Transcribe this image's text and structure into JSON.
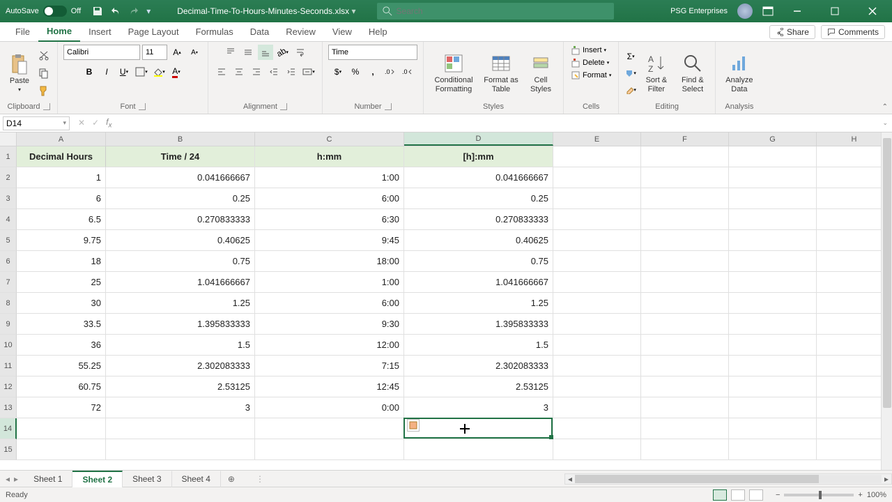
{
  "titlebar": {
    "autosave_label": "AutoSave",
    "autosave_state": "Off",
    "filename": "Decimal-Time-To-Hours-Minutes-Seconds.xlsx",
    "search_placeholder": "Search",
    "user_label": "PSG Enterprises"
  },
  "ribbon_tabs": [
    "File",
    "Home",
    "Insert",
    "Page Layout",
    "Formulas",
    "Data",
    "Review",
    "View",
    "Help"
  ],
  "ribbon_active": "Home",
  "share_label": "Share",
  "comments_label": "Comments",
  "ribbon": {
    "clipboard": {
      "label": "Clipboard",
      "paste": "Paste"
    },
    "font": {
      "label": "Font",
      "name": "Calibri",
      "size": "11"
    },
    "alignment": {
      "label": "Alignment"
    },
    "number": {
      "label": "Number",
      "format": "Time"
    },
    "styles": {
      "label": "Styles",
      "cond": "Conditional Formatting",
      "table": "Format as Table",
      "cell": "Cell Styles"
    },
    "cells": {
      "label": "Cells",
      "insert": "Insert",
      "delete": "Delete",
      "format": "Format"
    },
    "editing": {
      "label": "Editing",
      "sort": "Sort & Filter",
      "find": "Find & Select"
    },
    "analysis": {
      "label": "Analysis",
      "analyze": "Analyze Data"
    }
  },
  "namebox": "D14",
  "formula": "",
  "columns": [
    "A",
    "B",
    "C",
    "D",
    "E",
    "F",
    "G",
    "H"
  ],
  "col_classes": [
    "cw-A",
    "cw-B",
    "cw-C",
    "cw-D",
    "cw-E",
    "cw-F",
    "cw-G",
    "cw-H"
  ],
  "selected_col": "D",
  "headers": [
    "Decimal Hours",
    "Time / 24",
    "h:mm",
    "[h]:mm"
  ],
  "rows": [
    {
      "n": "1"
    },
    {
      "n": "2",
      "A": "1",
      "B": "0.041666667",
      "C": "1:00",
      "D": "0.041666667"
    },
    {
      "n": "3",
      "A": "6",
      "B": "0.25",
      "C": "6:00",
      "D": "0.25"
    },
    {
      "n": "4",
      "A": "6.5",
      "B": "0.270833333",
      "C": "6:30",
      "D": "0.270833333"
    },
    {
      "n": "5",
      "A": "9.75",
      "B": "0.40625",
      "C": "9:45",
      "D": "0.40625"
    },
    {
      "n": "6",
      "A": "18",
      "B": "0.75",
      "C": "18:00",
      "D": "0.75"
    },
    {
      "n": "7",
      "A": "25",
      "B": "1.041666667",
      "C": "1:00",
      "D": "1.041666667"
    },
    {
      "n": "8",
      "A": "30",
      "B": "1.25",
      "C": "6:00",
      "D": "1.25"
    },
    {
      "n": "9",
      "A": "33.5",
      "B": "1.395833333",
      "C": "9:30",
      "D": "1.395833333"
    },
    {
      "n": "10",
      "A": "36",
      "B": "1.5",
      "C": "12:00",
      "D": "1.5"
    },
    {
      "n": "11",
      "A": "55.25",
      "B": "2.302083333",
      "C": "7:15",
      "D": "2.302083333"
    },
    {
      "n": "12",
      "A": "60.75",
      "B": "2.53125",
      "C": "12:45",
      "D": "2.53125"
    },
    {
      "n": "13",
      "A": "72",
      "B": "3",
      "C": "0:00",
      "D": "3"
    },
    {
      "n": "14"
    },
    {
      "n": "15"
    }
  ],
  "selected_row": "14",
  "sheets": [
    "Sheet 1",
    "Sheet 2",
    "Sheet 3",
    "Sheet 4"
  ],
  "active_sheet": "Sheet 2",
  "status": {
    "ready": "Ready",
    "zoom": "100%"
  }
}
